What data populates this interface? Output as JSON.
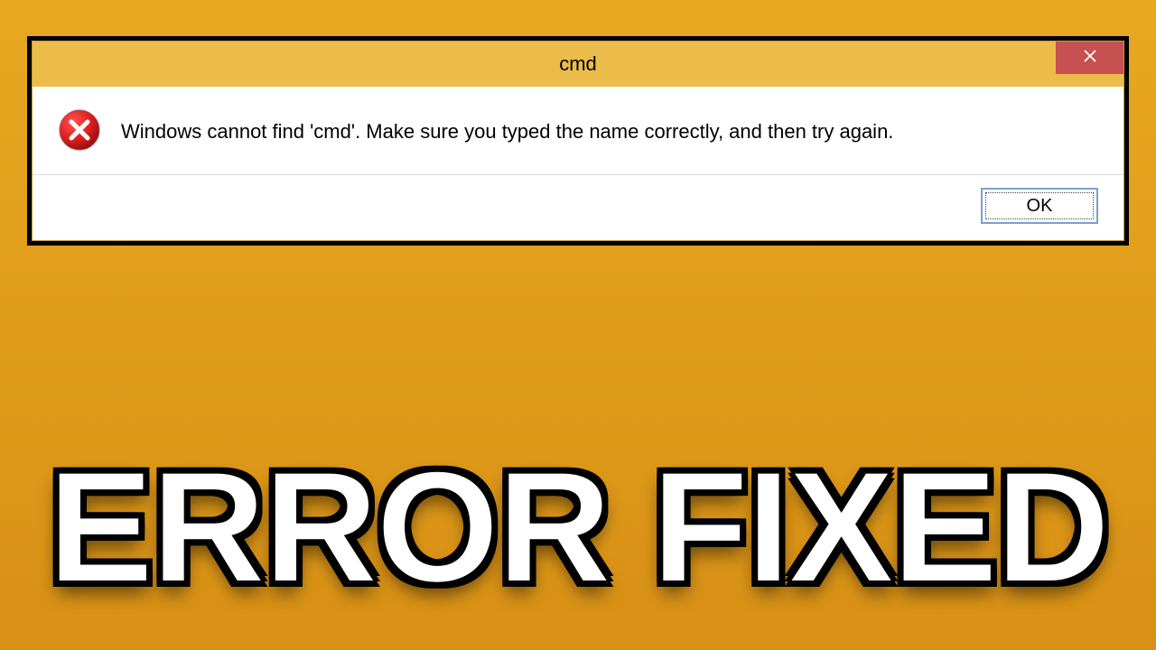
{
  "dialog": {
    "title": "cmd",
    "message": "Windows cannot find 'cmd'. Make sure you typed the name correctly, and then try again.",
    "ok_label": "OK"
  },
  "overlay": {
    "caption": "ERROR FIXED"
  },
  "colors": {
    "background_top": "#e8a820",
    "background_bottom": "#d89015",
    "titlebar": "#ebbc4a",
    "close_button": "#c75050",
    "ok_border": "#7a9fd4"
  }
}
